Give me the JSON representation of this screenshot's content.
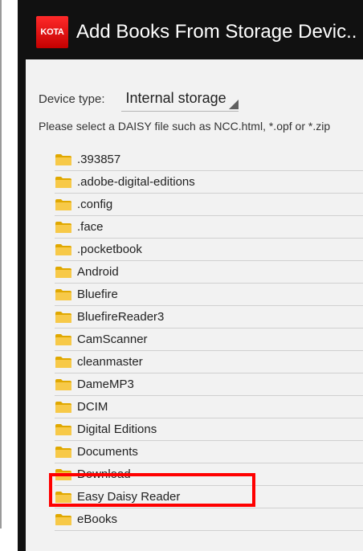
{
  "app": {
    "logo_text": "KOTA",
    "title": "Add Books From Storage Devic..."
  },
  "device": {
    "label": "Device type:",
    "selected": "Internal storage"
  },
  "instruction": "Please select a DAISY file such as NCC.html, *.opf or *.zip",
  "folders": [
    ".393857",
    ".adobe-digital-editions",
    ".config",
    ".face",
    ".pocketbook",
    "Android",
    "Bluefire",
    "BluefireReader3",
    "CamScanner",
    "cleanmaster",
    "DameMP3",
    "DCIM",
    "Digital Editions",
    "Documents",
    "Download",
    "Easy Daisy Reader",
    "eBooks"
  ],
  "highlighted_folder": "Download",
  "colors": {
    "highlight": "#ff0000",
    "folder": "#f5c518",
    "titlebar": "#111111"
  }
}
